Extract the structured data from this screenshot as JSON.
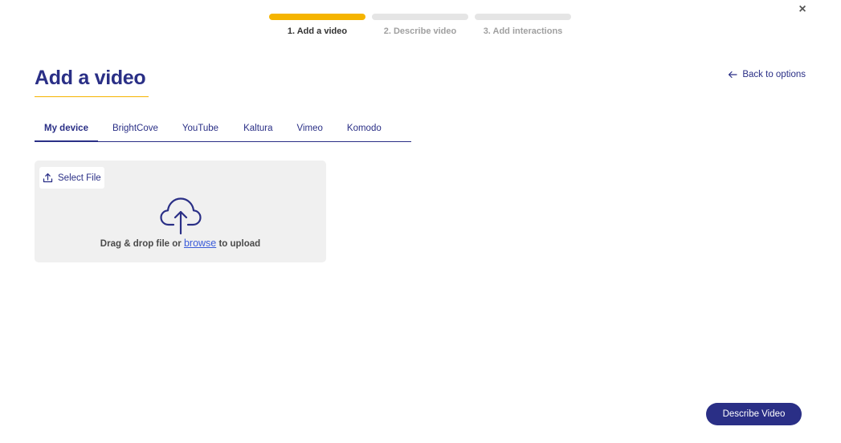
{
  "stepper": {
    "steps": [
      {
        "label": "1. Add a video",
        "active": true
      },
      {
        "label": "2. Describe video",
        "active": false
      },
      {
        "label": "3. Add interactions",
        "active": false
      }
    ]
  },
  "close": {
    "glyph": "×",
    "icon": "close-icon"
  },
  "page": {
    "title": "Add a video"
  },
  "back_link": {
    "label": "Back to options",
    "icon": "arrow-left-icon"
  },
  "tabs": [
    {
      "label": "My device",
      "active": true
    },
    {
      "label": "BrightCove",
      "active": false
    },
    {
      "label": "YouTube",
      "active": false
    },
    {
      "label": "Kaltura",
      "active": false
    },
    {
      "label": "Vimeo",
      "active": false
    },
    {
      "label": "Komodo",
      "active": false
    }
  ],
  "dropzone": {
    "select_file_label": "Select File",
    "select_file_icon": "upload-icon",
    "cloud_icon": "cloud-upload-icon",
    "text_before": "Drag & drop file or ",
    "browse_label": "browse",
    "text_after": " to upload"
  },
  "footer": {
    "primary_label": "Describe Video"
  },
  "colors": {
    "primary": "#2a2f86",
    "accent": "#f5b400",
    "link": "#3a5bd9",
    "dropzone_bg": "#f0f0f0"
  }
}
